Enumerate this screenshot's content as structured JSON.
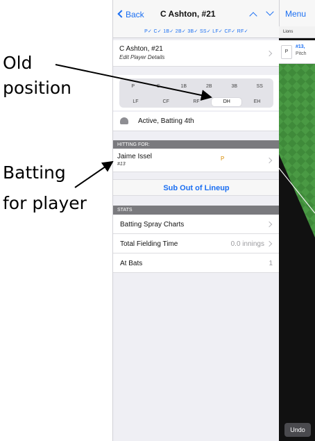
{
  "annotations": {
    "old_line1": "Old",
    "old_line2": "position",
    "bat_line1": "Batting",
    "bat_line2": "for player"
  },
  "navbar": {
    "back_label": "Back",
    "title": "C Ashton, #21"
  },
  "position_checks": "P✓ C✓ 1B✓ 2B✓ 3B✓ SS✓ LF✓ CF✓ RF✓",
  "player": {
    "name": "C Ashton, #21",
    "edit_label": "Edit Player Details"
  },
  "positions": {
    "row1": [
      "P",
      "C",
      "1B",
      "2B",
      "3B",
      "SS"
    ],
    "row2": [
      "LF",
      "CF",
      "RF",
      "DH",
      "EH"
    ],
    "selected": "DH"
  },
  "status": {
    "text": "Active, Batting 4th"
  },
  "hitting_for": {
    "header": "HITTING FOR:",
    "name": "Jaime Issel",
    "number": "#13",
    "position": "P"
  },
  "sub_out_label": "Sub Out of Lineup",
  "stats": {
    "header": "STATS",
    "spray_label": "Batting Spray Charts",
    "fielding_label": "Total Fielding Time",
    "fielding_value": "0.0 innings",
    "at_bats_label": "At Bats",
    "at_bats_value": "1"
  },
  "right_panel": {
    "menu_label": "Menu",
    "team": "Lions",
    "card_pos": "P",
    "card_number": "#13,",
    "card_role": "Pitch",
    "undo_label": "Undo"
  },
  "colors": {
    "accent": "#1b6ff2",
    "position_tag": "#d98b00",
    "field_green": "#3f8a3a"
  }
}
